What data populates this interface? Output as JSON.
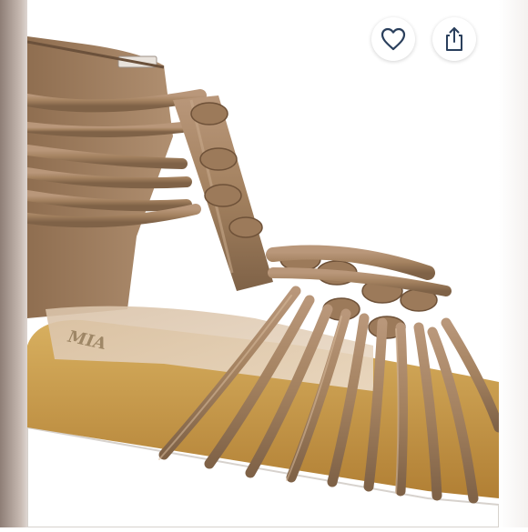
{
  "actions": {
    "like": {
      "icon": "heart-outline-icon",
      "label": "Like"
    },
    "share": {
      "icon": "share-upload-icon",
      "label": "Share"
    }
  },
  "photo": {
    "subject": "sandal",
    "brand_mark": "MIA"
  },
  "colors": {
    "strap": "#a98867",
    "strap_shadow": "#7f6247",
    "footbed": "#c4964a",
    "sole": "#ffffff",
    "icon": "#2a3f5c"
  }
}
